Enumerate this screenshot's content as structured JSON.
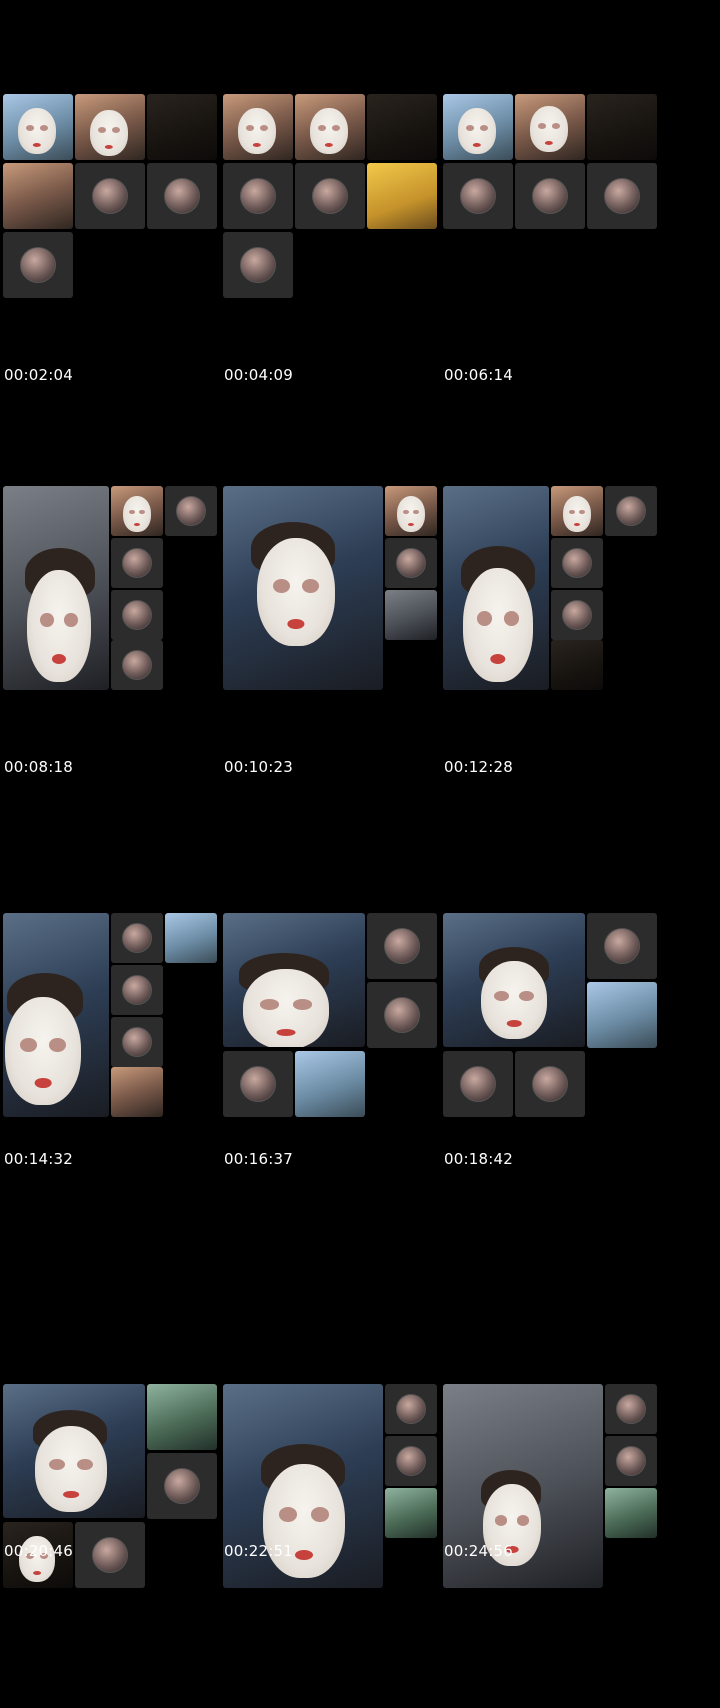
{
  "timestamps": [
    "00:02:04",
    "00:04:09",
    "00:06:14",
    "00:08:18",
    "00:10:23",
    "00:12:28",
    "00:14:32",
    "00:16:37",
    "00:18:42",
    "00:20:46",
    "00:22:51",
    "00:24:56"
  ],
  "icons": {
    "participant_avatar": "profile-avatar-icon"
  },
  "colors": {
    "background": "#000000",
    "avatar_tile": "#2d2c2c",
    "timestamp_text": "#ffffff"
  }
}
